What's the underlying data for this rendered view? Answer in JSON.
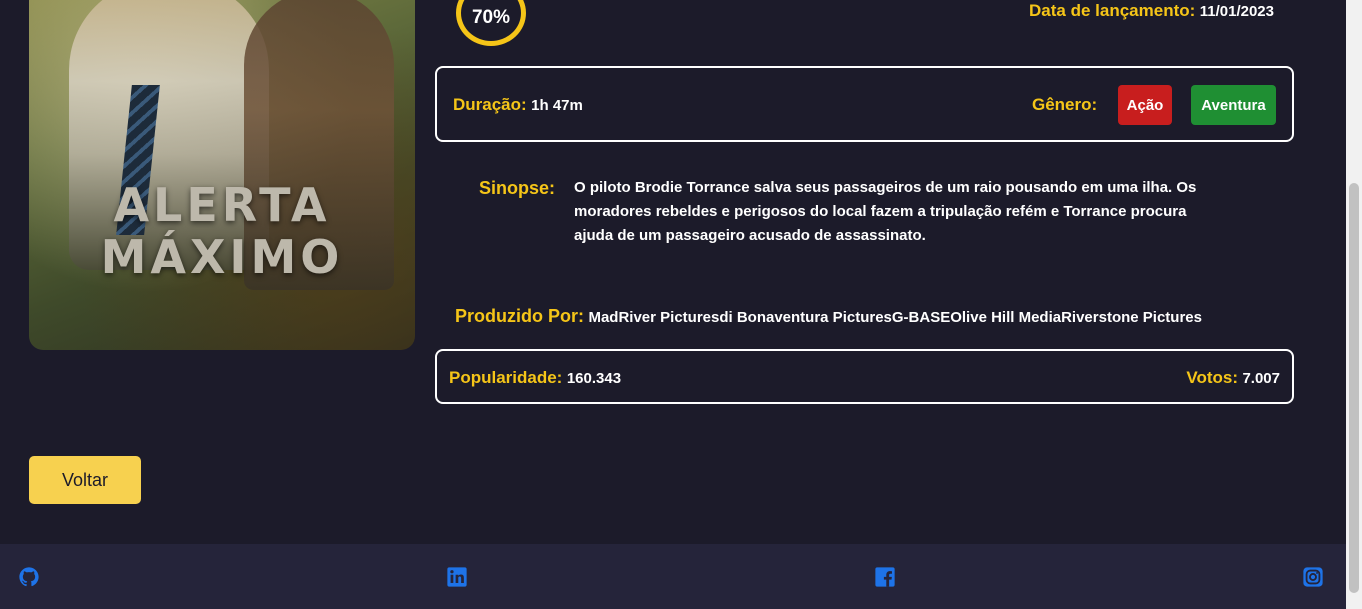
{
  "poster": {
    "title_line1": "ALERTA",
    "title_line2": "MÁXIMO"
  },
  "rating": {
    "value": "70%"
  },
  "release": {
    "label": "Data de lançamento:",
    "value": "11/01/2023"
  },
  "details": {
    "duration_label": "Duração:",
    "duration_value": "1h 47m",
    "genre_label": "Gênero:",
    "genres": [
      "Ação",
      "Aventura"
    ]
  },
  "synopsis": {
    "label": "Sinopse:",
    "text": "O piloto Brodie Torrance salva seus passageiros de um raio pousando em uma ilha. Os moradores rebeldes e perigosos do local fazem a tripulação refém e Torrance procura ajuda de um passageiro acusado de assassinato."
  },
  "production": {
    "label": "Produzido Por:",
    "value": "MadRiver Picturesdi Bonaventura PicturesG-BASEOlive Hill MediaRiverstone Pictures"
  },
  "stats": {
    "popularity_label": "Popularidade:",
    "popularity_value": "160.343",
    "votes_label": "Votos:",
    "votes_value": "7.007"
  },
  "back_button": {
    "label": "Voltar"
  },
  "footer": {
    "icons": [
      "github-icon",
      "linkedin-icon",
      "facebook-icon",
      "instagram-icon"
    ]
  },
  "colors": {
    "background": "#1c1b2a",
    "accent": "#f5c518",
    "button": "#f7d14f",
    "genre_action": "#c81e1e",
    "genre_adventure": "#1f8f33",
    "footer": "#25243a",
    "social_icon": "#1e73e8"
  }
}
